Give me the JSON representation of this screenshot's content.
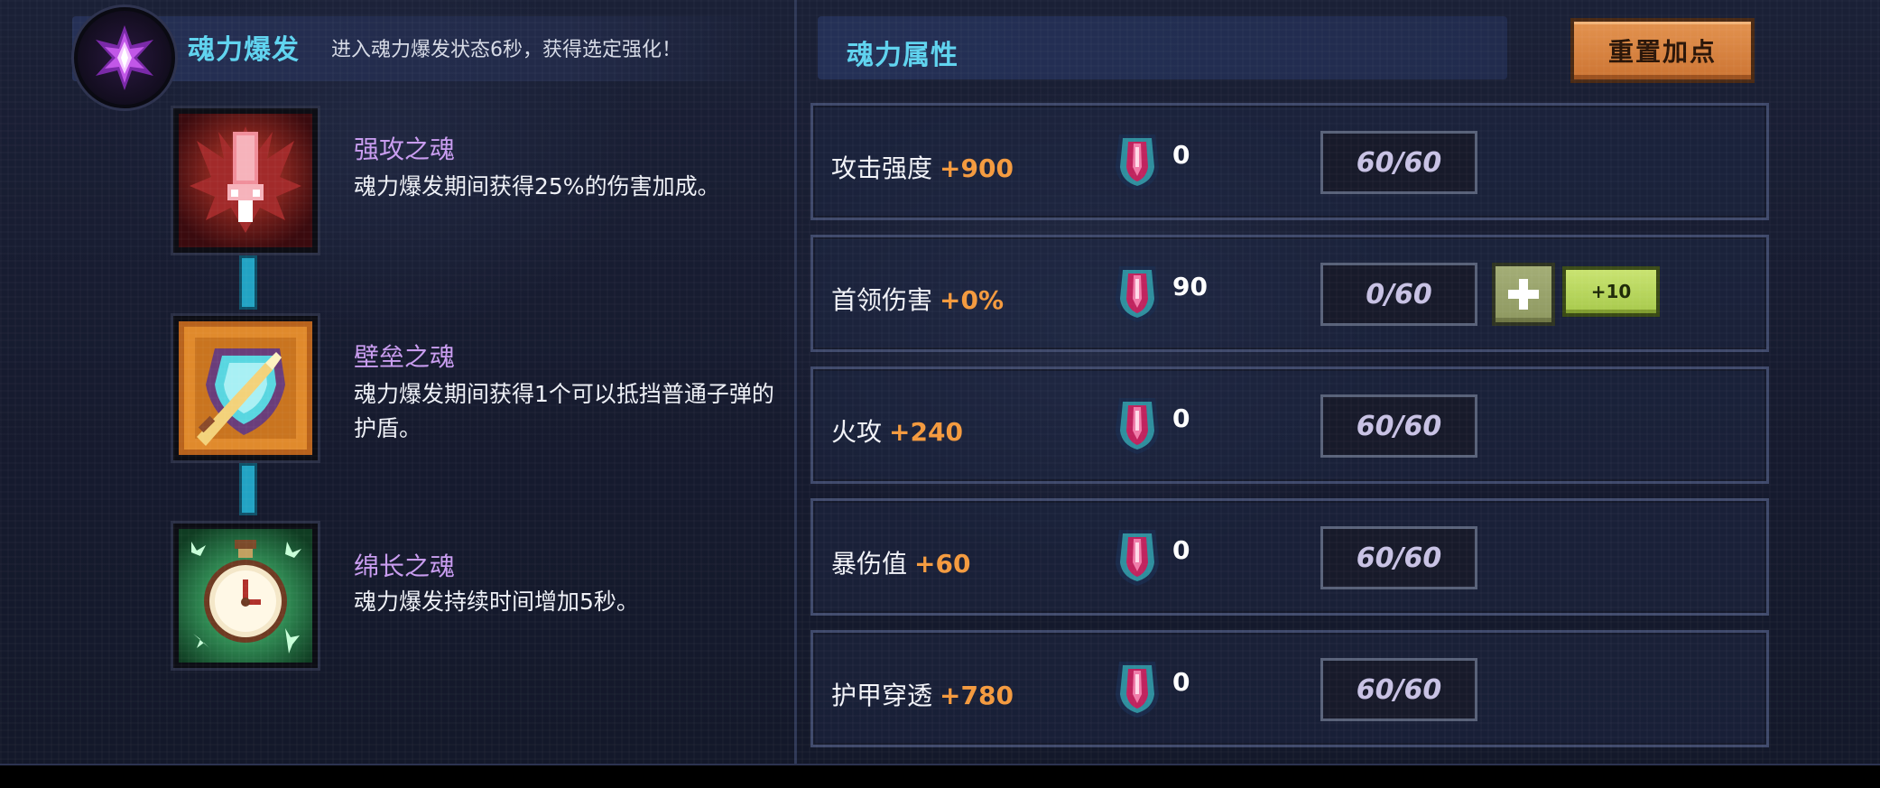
{
  "header": {
    "burst_title": "魂力爆发",
    "burst_subtitle": "进入魂力爆发状态6秒，获得选定强化！",
    "props_title": "魂力属性",
    "reset_label": "重置加点"
  },
  "skills": [
    {
      "name": "强攻之魂",
      "desc": "魂力爆发期间获得25%的伤害加成。"
    },
    {
      "name": "壁垒之魂",
      "desc": "魂力爆发期间获得1个可以抵挡普通子弹的护盾。"
    },
    {
      "name": "绵长之魂",
      "desc": "魂力爆发持续时间增加5秒。"
    }
  ],
  "attributes": [
    {
      "name": "攻击强度",
      "bonus": "+900",
      "gems": "0",
      "level": "60/60"
    },
    {
      "name": "首领伤害",
      "bonus": "+0%",
      "gems": "90",
      "level": "0/60",
      "plus_label": "+10"
    },
    {
      "name": "火攻",
      "bonus": "+240",
      "gems": "0",
      "level": "60/60"
    },
    {
      "name": "暴伤值",
      "bonus": "+60",
      "gems": "0",
      "level": "60/60"
    },
    {
      "name": "护甲穿透",
      "bonus": "+780",
      "gems": "0",
      "level": "60/60"
    }
  ],
  "colors": {
    "title": "#5fd3ef",
    "skill_name": "#c99cf0",
    "bonus": "#f49a3e",
    "reset_button": "#d9843f",
    "plus10_button": "#b8d85c"
  },
  "icons": {
    "burst": "purple-crystal-emblem-icon",
    "skill_1": "red-squid-icon",
    "skill_2": "shield-sword-icon",
    "skill_3": "green-stopwatch-icon",
    "gem": "soul-gem-icon",
    "plus": "plus-icon"
  }
}
